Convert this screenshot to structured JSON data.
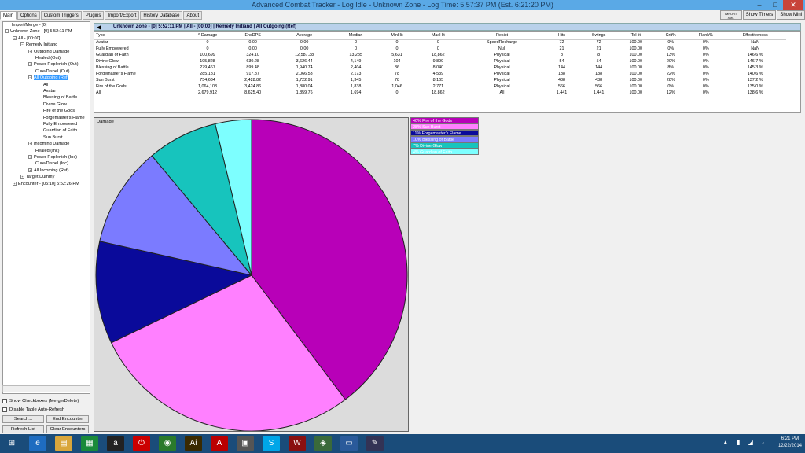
{
  "title": "Advanced Combat Tracker - Log Idle - Unknown Zone - Log Time: 5:57:37 PM (Est. 6:21:20 PM)",
  "window_controls": [
    "–",
    "□",
    "✕"
  ],
  "tabs": [
    "Main",
    "Options",
    "Custom Triggers",
    "Plugins",
    "Import/Export",
    "History Database",
    "About"
  ],
  "top_buttons": [
    "Show Timers",
    "Show Mini"
  ],
  "import_icon_label": "IMPORT XML",
  "tree": [
    {
      "label": "Import/Merge - [0]",
      "indent": 0,
      "exp": ""
    },
    {
      "label": "Unknown Zone - [0] 5:52:11 PM",
      "indent": 0,
      "exp": "−"
    },
    {
      "label": "All - [00:00]",
      "indent": 1,
      "exp": "−"
    },
    {
      "label": "Remedy Initiand",
      "indent": 2,
      "exp": "−"
    },
    {
      "label": "Outgoing Damage",
      "indent": 3,
      "exp": "+"
    },
    {
      "label": "Healed (Out)",
      "indent": 3,
      "exp": ""
    },
    {
      "label": "Power Replenish (Out)",
      "indent": 3,
      "exp": "+"
    },
    {
      "label": "Cure/Dispel (Out)",
      "indent": 3,
      "exp": ""
    },
    {
      "label": "All Outgoing (Ref)",
      "indent": 3,
      "exp": "−",
      "selected": true
    },
    {
      "label": "All",
      "indent": 4,
      "exp": ""
    },
    {
      "label": "Avatar",
      "indent": 4,
      "exp": ""
    },
    {
      "label": "Blessing of Battle",
      "indent": 4,
      "exp": ""
    },
    {
      "label": "Divine Glow",
      "indent": 4,
      "exp": ""
    },
    {
      "label": "Fire of the Gods",
      "indent": 4,
      "exp": ""
    },
    {
      "label": "Forgemaster's Flame",
      "indent": 4,
      "exp": ""
    },
    {
      "label": "Fully Empowered",
      "indent": 4,
      "exp": ""
    },
    {
      "label": "Guardian of Faith",
      "indent": 4,
      "exp": ""
    },
    {
      "label": "Sun Burst",
      "indent": 4,
      "exp": ""
    },
    {
      "label": "Incoming Damage",
      "indent": 3,
      "exp": "+"
    },
    {
      "label": "Healed (Inc)",
      "indent": 3,
      "exp": ""
    },
    {
      "label": "Power Replenish (Inc)",
      "indent": 3,
      "exp": "+"
    },
    {
      "label": "Cure/Dispel (Inc)",
      "indent": 3,
      "exp": ""
    },
    {
      "label": "All Incoming (Ref)",
      "indent": 3,
      "exp": "+"
    },
    {
      "label": "Target Dummy",
      "indent": 2,
      "exp": "+"
    },
    {
      "label": "Encounter - [05:10] 5:52:26 PM",
      "indent": 1,
      "exp": "+"
    }
  ],
  "options": {
    "show_checkboxes": "Show Checkboxes (Merge/Delete)",
    "disable_refresh": "Disable Table Auto-Refresh"
  },
  "buttons": {
    "search": "Search...",
    "end_encounter": "End Encounter",
    "refresh_list": "Refresh List",
    "clear_encounters": "Clear Encounters"
  },
  "path": "Unknown Zone - [0] 5:52:11 PM | All - [00:00] | Remedy Initiand | All Outgoing (Ref)",
  "back_arrow": "◀",
  "table": {
    "columns": [
      "Type",
      "Damage",
      "EncDPS",
      "Average",
      "Median",
      "MinHit",
      "MaxHit",
      "Resist",
      "Hits",
      "Swings",
      "ToHit",
      "Crit%",
      "Flank%",
      "Effectiveness"
    ],
    "sort_indicator": "^",
    "rows": [
      [
        "Avatar",
        "0",
        "0.00",
        "0.00",
        "0",
        "0",
        "0",
        "SpeedRecharge",
        "72",
        "72",
        "100.00",
        "0%",
        "0%",
        "NaN"
      ],
      [
        "Fully Empowered",
        "0",
        "0.00",
        "0.00",
        "0",
        "0",
        "0",
        "Null",
        "21",
        "21",
        "100.00",
        "0%",
        "0%",
        "NaN"
      ],
      [
        "Guardian of Faith",
        "100,699",
        "324.10",
        "12,587.38",
        "13,285",
        "5,631",
        "18,862",
        "Physical",
        "8",
        "8",
        "100.00",
        "13%",
        "0%",
        "146.6 %"
      ],
      [
        "Divine Glow",
        "195,828",
        "630.28",
        "3,626.44",
        "4,149",
        "104",
        "9,899",
        "Physical",
        "54",
        "54",
        "100.00",
        "20%",
        "0%",
        "146.7 %"
      ],
      [
        "Blessing of Battle",
        "279,467",
        "899.48",
        "1,940.74",
        "2,404",
        "36",
        "8,040",
        "Physical",
        "144",
        "144",
        "100.00",
        "8%",
        "0%",
        "145.3 %"
      ],
      [
        "Forgemaster's Flame",
        "285,181",
        "917.87",
        "2,066.53",
        "2,173",
        "78",
        "4,539",
        "Physical",
        "138",
        "138",
        "100.00",
        "22%",
        "0%",
        "140.6 %"
      ],
      [
        "Sun Burst",
        "754,634",
        "2,428.82",
        "1,722.91",
        "1,345",
        "78",
        "8,165",
        "Physical",
        "438",
        "438",
        "100.00",
        "28%",
        "0%",
        "137.2 %"
      ],
      [
        "Fire of the Gods",
        "1,064,103",
        "3,424.86",
        "1,880.04",
        "1,838",
        "1,046",
        "2,771",
        "Physical",
        "566",
        "566",
        "100.00",
        "0%",
        "0%",
        "135.0 %"
      ],
      [
        "All",
        "2,679,912",
        "8,625.40",
        "1,859.76",
        "1,694",
        "0",
        "18,862",
        "All",
        "1,441",
        "1,441",
        "100.00",
        "12%",
        "0%",
        "138.6 %"
      ]
    ]
  },
  "chart_title": "Damage",
  "chart_data": {
    "type": "pie",
    "title": "Damage",
    "slices": [
      {
        "label": "40% Fire of the Gods",
        "value": 1064103,
        "color": "#b800b8"
      },
      {
        "label": "28% Sun Burst",
        "value": 754634,
        "color": "#ff80ff"
      },
      {
        "label": "11% Forgemaster's Flame",
        "value": 285181,
        "color": "#0a0a9a"
      },
      {
        "label": "10% Blessing of Battle",
        "value": 279467,
        "color": "#7b7bff"
      },
      {
        "label": "7% Divine Glow",
        "value": 195828,
        "color": "#17c4bd"
      },
      {
        "label": "4% Guardian of Faith",
        "value": 100699,
        "color": "#7dffff"
      }
    ]
  },
  "taskbar": {
    "icons": [
      {
        "name": "windows-start-icon",
        "glyph": "⊞",
        "color": "#1a4c7a"
      },
      {
        "name": "ie-icon",
        "glyph": "e",
        "color": "#1e6cc0"
      },
      {
        "name": "explorer-icon",
        "glyph": "▤",
        "color": "#d9a63b"
      },
      {
        "name": "store-icon",
        "glyph": "▦",
        "color": "#1a8a3a"
      },
      {
        "name": "amazon-icon",
        "glyph": "a",
        "color": "#222"
      },
      {
        "name": "power-icon",
        "glyph": "⏻",
        "color": "#c00"
      },
      {
        "name": "chrome-icon",
        "glyph": "◉",
        "color": "#2a7a2a"
      },
      {
        "name": "illustrator-icon",
        "glyph": "Ai",
        "color": "#3a2a00"
      },
      {
        "name": "pdf-icon",
        "glyph": "A",
        "color": "#b00"
      },
      {
        "name": "app-icon",
        "glyph": "▣",
        "color": "#555"
      },
      {
        "name": "skype-icon",
        "glyph": "S",
        "color": "#00a6e8"
      },
      {
        "name": "game-icon",
        "glyph": "W",
        "color": "#8a1010"
      },
      {
        "name": "act-icon",
        "glyph": "◈",
        "color": "#3a6a3a"
      },
      {
        "name": "photos-icon",
        "glyph": "▭",
        "color": "#2a5a9a"
      },
      {
        "name": "paint-icon",
        "glyph": "✎",
        "color": "#335"
      }
    ],
    "time": "6:21 PM",
    "date": "12/22/2014"
  }
}
